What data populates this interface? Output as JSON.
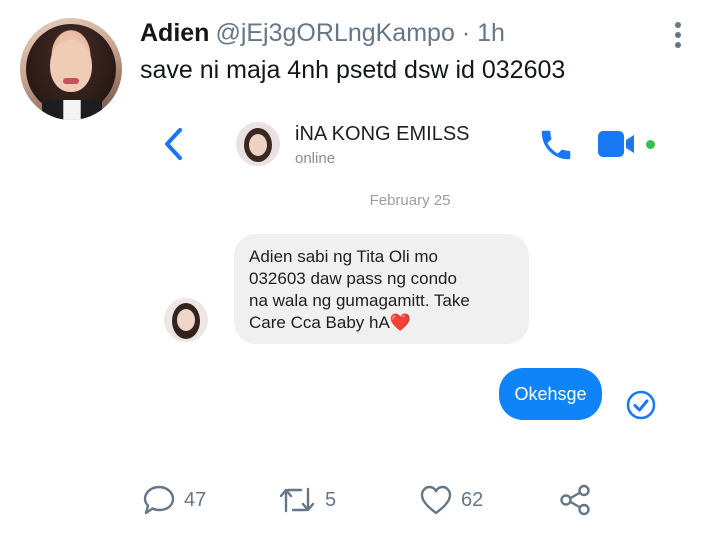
{
  "tweet": {
    "author": {
      "display_name": "Adien",
      "handle": "@jEj3gORLngKampo",
      "time": "· 1h"
    },
    "text": "save ni maja 4nh psetd dsw id 032603"
  },
  "chat": {
    "contact_name": "iNA KONG EMILSS",
    "contact_status": "online",
    "date": "February 25",
    "received_message": {
      "lines": [
        "Adien sabi ng Tita Oli mo",
        "032603 daw pass ng condo",
        "na wala ng gumagamitt. Take",
        "Care Cca Baby hA"
      ],
      "emoji": "❤️"
    },
    "sent_message": "Okehsge",
    "colors": {
      "accent": "#0f84f8",
      "online": "#31c24d"
    }
  },
  "actions": {
    "replies": "47",
    "retweets": "5",
    "likes": "62"
  },
  "icons": [
    "more-vertical-icon",
    "back-chevron-icon",
    "phone-icon",
    "video-call-icon",
    "seen-check-icon",
    "reply-icon",
    "retweet-icon",
    "like-icon",
    "share-icon"
  ]
}
